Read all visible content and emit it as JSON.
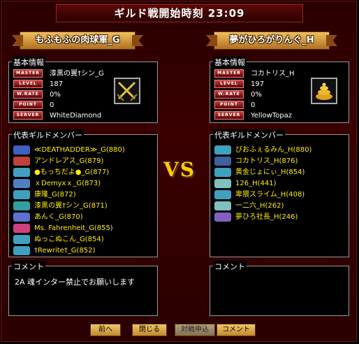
{
  "header": {
    "title": "ギルド戦開始時刻 23:09"
  },
  "left": {
    "guild_name": "もふもふの肉球軍_G",
    "info_title": "基本情報",
    "info": [
      {
        "badge": "MASTER",
        "value": "漆黒の翼†シン_G"
      },
      {
        "badge": "LEVEL",
        "value": "187"
      },
      {
        "badge": "W.RATE",
        "value": "0%"
      },
      {
        "badge": "POINT",
        "value": "0"
      },
      {
        "badge": "SERVER",
        "value": "WhiteDiamond"
      }
    ],
    "emblem_icon": "crossed-swords-icon",
    "members_title": "代表ギルドメンバー",
    "members": [
      {
        "name": "≪DEATHADDER≫_G(880)",
        "icon_color": "#4060c0"
      },
      {
        "name": "アンドレアス_G(879)",
        "icon_color": "#c04040"
      },
      {
        "name": "●もっちだよ●_G(877)",
        "icon_color": "#40a0c0"
      },
      {
        "name": "ｘDemyxｘ_G(873)",
        "icon_color": "#5080c0"
      },
      {
        "name": "康隆_G(872)",
        "icon_color": "#40a0c0"
      },
      {
        "name": "漆黒の翼†シン_G(871)",
        "icon_color": "#30a0a0"
      },
      {
        "name": "あんく_G(870)",
        "icon_color": "#6070d0"
      },
      {
        "name": "Ms. Fahrenheit_G(855)",
        "icon_color": "#d04080"
      },
      {
        "name": "ぬっこぬこん_G(854)",
        "icon_color": "#40a0c0"
      },
      {
        "name": "†Rewrite†_G(852)",
        "icon_color": "#40a0c0"
      }
    ],
    "comment_title": "コメント",
    "comment": "2A  魂インター禁止でお願いします"
  },
  "right": {
    "guild_name": "夢がひろがりんぐ_H",
    "info_title": "基本情報",
    "info": [
      {
        "badge": "MASTER",
        "value": "コカトリス_H"
      },
      {
        "badge": "LEVEL",
        "value": "197"
      },
      {
        "badge": "W.RATE",
        "value": "0%"
      },
      {
        "badge": "POINT",
        "value": "0"
      },
      {
        "badge": "SERVER",
        "value": "YellowTopaz"
      }
    ],
    "emblem_icon": "swirl-icon",
    "members_title": "代表ギルドメンバー",
    "members": [
      {
        "name": "ぴおふぇるみん_H(880)",
        "icon_color": "#40a0c0"
      },
      {
        "name": "コカトリス_H(876)",
        "icon_color": "#4060a0"
      },
      {
        "name": "黄金じょにぃ_H(854)",
        "icon_color": "#40a0c0"
      },
      {
        "name": "126_H(441)",
        "icon_color": "#80c0c0"
      },
      {
        "name": "卑猥スライム_H(408)",
        "icon_color": "#40a0c0"
      },
      {
        "name": "一二六_H(262)",
        "icon_color": "#80c0c0"
      },
      {
        "name": "夢ひろ社長_H(246)",
        "icon_color": "#8060c0"
      }
    ],
    "comment_title": "コメント",
    "comment": ""
  },
  "vs_label": "VS",
  "buttons": {
    "prev": "前へ",
    "close": "閉じる",
    "apply": "対戦申込",
    "comment": "コメント"
  }
}
